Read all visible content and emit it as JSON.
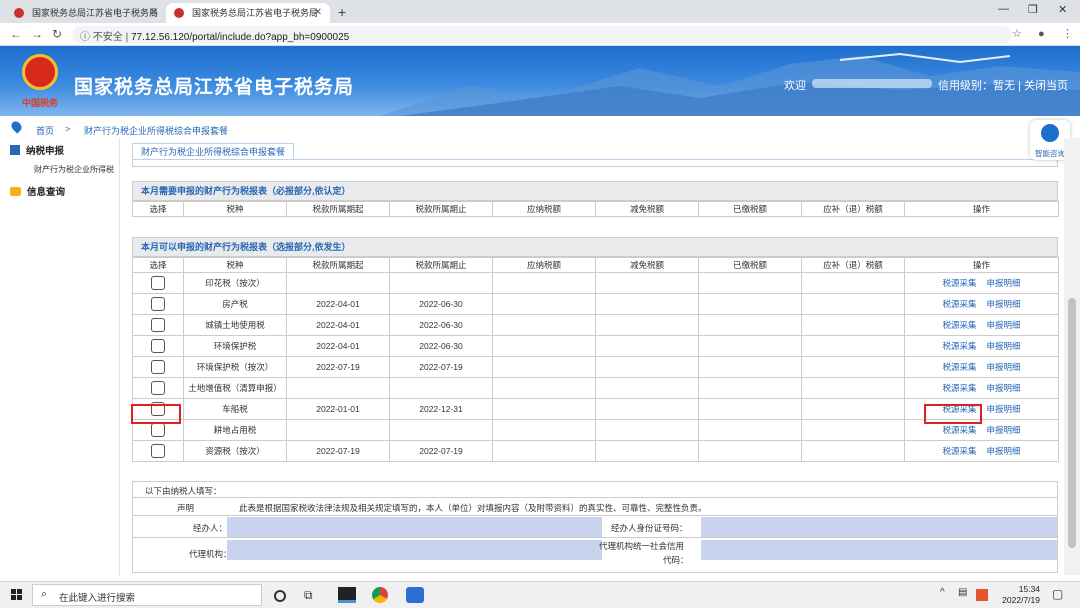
{
  "browser": {
    "tabs": [
      {
        "title": "国家税务总局江苏省电子税务局"
      },
      {
        "title": "国家税务总局江苏省电子税务局"
      }
    ],
    "security_label": "不安全",
    "url": "77.12.56.120/portal/include.do?app_bh=0900025"
  },
  "header": {
    "emblem_caption": "中国税务",
    "site_title": "国家税务总局江苏省电子税务局",
    "welcome": "欢迎",
    "credit_level": "信用级别：暂无",
    "close_page": "关闭当页"
  },
  "breadcrumb": {
    "home": "首页",
    "separator": ">",
    "current": "财产行为税企业所得税综合申报套餐"
  },
  "sidebar": {
    "tax_filing": "纳税申报",
    "sub_item": "财产行为税企业所得税",
    "info_query": "信息查询"
  },
  "helper": {
    "label": "智能咨询"
  },
  "content_tab": "财产行为税企业所得税综合申报套餐",
  "required_section": {
    "title": "本月需要申报的财产行为税报表（必报部分,依认定）",
    "headers": [
      "选择",
      "税种",
      "税款所属期起",
      "税款所属期止",
      "应纳税额",
      "减免税额",
      "已缴税额",
      "应补（退）税额",
      "操作"
    ]
  },
  "optional_section": {
    "title": "本月可以申报的财产行为税报表（选报部分,依发生）",
    "headers": [
      "选择",
      "税种",
      "税款所属期起",
      "税款所属期止",
      "应纳税额",
      "减免税额",
      "已缴税额",
      "应补（退）税额",
      "操作"
    ],
    "action_collect": "税源采集",
    "action_detail": "申报明细",
    "rows": [
      {
        "tax": "印花税（按次）",
        "start": "",
        "end": ""
      },
      {
        "tax": "房产税",
        "start": "2022-04-01",
        "end": "2022-06-30"
      },
      {
        "tax": "城镇土地使用税",
        "start": "2022-04-01",
        "end": "2022-06-30"
      },
      {
        "tax": "环境保护税",
        "start": "2022-04-01",
        "end": "2022-06-30"
      },
      {
        "tax": "环境保护税（按次）",
        "start": "2022-07-19",
        "end": "2022-07-19"
      },
      {
        "tax": "土地增值税（清算申报）",
        "start": "",
        "end": ""
      },
      {
        "tax": "车船税",
        "start": "2022-01-01",
        "end": "2022-12-31"
      },
      {
        "tax": "耕地占用税",
        "start": "",
        "end": ""
      },
      {
        "tax": "资源税（按次）",
        "start": "2022-07-19",
        "end": "2022-07-19"
      }
    ]
  },
  "declaration": {
    "intro": "以下由纳税人填写：",
    "statement_label": "声明",
    "statement_text": "此表是根据国家税收法律法规及相关规定填写的，本人（单位）对填报内容（及附带资料）的真实性、可靠性、完整性负责。",
    "handler_label": "经办人：",
    "handler_id_label": "经办人身份证号码：",
    "agency_label": "代理机构：",
    "agency_code_label_1": "代理机构统一社会信用",
    "agency_code_label_2": "代码："
  },
  "taskbar": {
    "search_placeholder": "在此键入进行搜索",
    "time": "15:34",
    "date": "2022/7/19"
  },
  "colors": {
    "banner": "#1d6fcf",
    "link": "#2767b6",
    "highlight": "#e02020",
    "input_fill": "#c8d3ee"
  }
}
